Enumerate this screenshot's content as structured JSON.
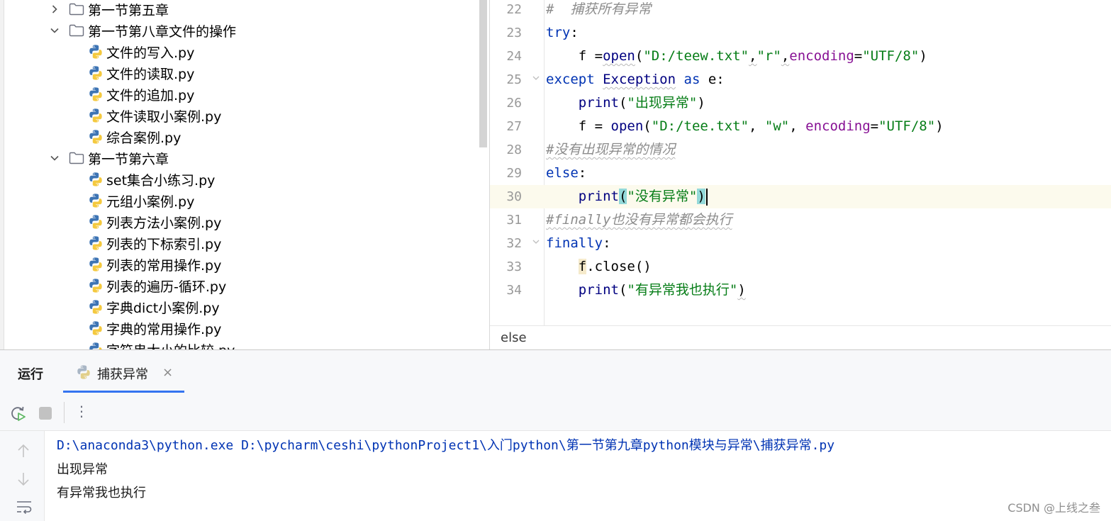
{
  "project_tree": {
    "rows": [
      {
        "type": "folder",
        "expanded": false,
        "label": "第一节第五章"
      },
      {
        "type": "folder",
        "expanded": true,
        "label": "第一节第八章文件的操作"
      },
      {
        "type": "file",
        "label": "文件的写入.py"
      },
      {
        "type": "file",
        "label": "文件的读取.py"
      },
      {
        "type": "file",
        "label": "文件的追加.py"
      },
      {
        "type": "file",
        "label": "文件读取小案例.py"
      },
      {
        "type": "file",
        "label": "综合案例.py"
      },
      {
        "type": "folder",
        "expanded": true,
        "label": "第一节第六章"
      },
      {
        "type": "file",
        "label": "set集合小练习.py"
      },
      {
        "type": "file",
        "label": "元组小案例.py"
      },
      {
        "type": "file",
        "label": "列表方法小案例.py"
      },
      {
        "type": "file",
        "label": "列表的下标索引.py"
      },
      {
        "type": "file",
        "label": "列表的常用操作.py"
      },
      {
        "type": "file",
        "label": "列表的遍历-循环.py"
      },
      {
        "type": "file",
        "label": "字典dict小案例.py"
      },
      {
        "type": "file",
        "label": "字典的常用操作.py"
      },
      {
        "type": "file",
        "label": "字符串大小的比较.py"
      }
    ]
  },
  "editor": {
    "line_numbers": [
      "22",
      "23",
      "24",
      "25",
      "26",
      "27",
      "28",
      "29",
      "30",
      "31",
      "32",
      "33",
      "34"
    ],
    "current_line": "30",
    "tokens": {
      "l22_comment": "#  捕获所有异常",
      "l23_try": "try",
      "l23_colon": ":",
      "l24_indent": "    ",
      "l24_f": "f =",
      "l24_open": "open",
      "l24_lp": "(",
      "l24_path": "\"D:/teew.txt\"",
      "l24_c1": ",",
      "l24_mode": "\"r\"",
      "l24_c2": ",",
      "l24_enc": "encoding",
      "l24_eq": "=",
      "l24_encval": "\"UTF/8\"",
      "l24_rp": ")",
      "l25_except": "except",
      "l25_sp1": " ",
      "l25_exc": "Exception",
      "l25_sp2": " ",
      "l25_as": "as",
      "l25_rest": " e:",
      "l26_indent": "    ",
      "l26_print": "print",
      "l26_lp": "(",
      "l26_str": "\"出现异常\"",
      "l26_rp": ")",
      "l27_indent": "    ",
      "l27_f": "f = ",
      "l27_open": "open",
      "l27_lp": "(",
      "l27_path": "\"D:/tee.txt\"",
      "l27_c1": ", ",
      "l27_mode": "\"w\"",
      "l27_c2": ", ",
      "l27_enc": "encoding",
      "l27_eq": "=",
      "l27_encval": "\"UTF/8\"",
      "l27_rp": ")",
      "l28_comment": "#没有出现异常的情况",
      "l29_else": "else",
      "l29_colon": ":",
      "l30_indent": "    ",
      "l30_print": "print",
      "l30_lp": "(",
      "l30_str": "\"没有异常\"",
      "l30_rp": ")",
      "l31_comment": "#finally也没有异常都会执行",
      "l32_finally": "finally",
      "l32_colon": ":",
      "l33_indent": "    ",
      "l33_f": "f",
      "l33_rest": ".close()",
      "l34_indent": "    ",
      "l34_print": "print",
      "l34_lp": "(",
      "l34_str": "\"有异常我也执行\"",
      "l34_rp": ")"
    },
    "breadcrumb": "else"
  },
  "run_panel": {
    "title": "运行",
    "tab_label": "捕获异常",
    "tab_close": "×",
    "toolbar_more": "⋮",
    "console": {
      "command": "D:\\anaconda3\\python.exe D:\\pycharm\\ceshi\\pythonProject1\\入门python\\第一节第九章python模块与异常\\捕获异常.py",
      "output": [
        "出现异常",
        "有异常我也执行"
      ]
    },
    "watermark": "CSDN @上线之叁"
  },
  "colors": {
    "keyword": "#0033b3",
    "string": "#067d17",
    "kwarg": "#871094",
    "comment": "#8c8c8c",
    "current_line_bg": "#fcfaed",
    "tab_underline": "#3574f0"
  }
}
